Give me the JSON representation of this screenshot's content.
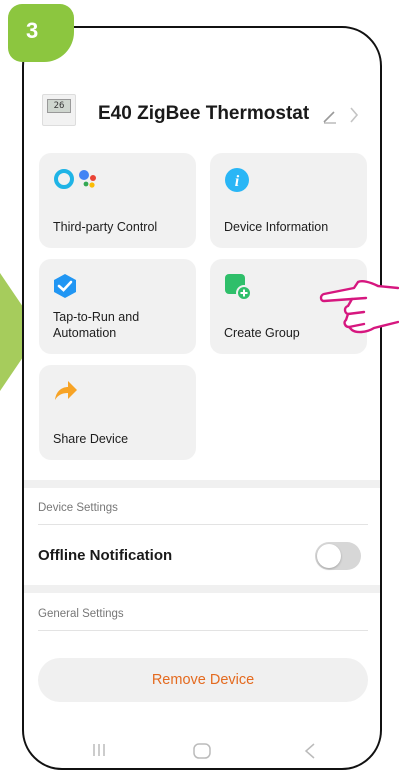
{
  "step": {
    "number": "3",
    "color": "#8cc63f"
  },
  "header": {
    "device_display": "26",
    "title": "E40 ZigBee Thermostat",
    "edit_icon": "pencil-icon",
    "chevron_icon": "chevron-right-icon"
  },
  "tiles": [
    {
      "label": "Third-party Control",
      "icon": "alexa-google-assistant-icons"
    },
    {
      "label": "Device Information",
      "icon": "info-icon"
    },
    {
      "label": "Tap-to-Run and\nAutomation",
      "icon": "automation-check-icon"
    },
    {
      "label": "Create Group",
      "icon": "create-group-icon"
    },
    {
      "label": "Share Device",
      "icon": "share-arrow-icon"
    }
  ],
  "device_settings": {
    "section_title": "Device Settings",
    "offline_notification": {
      "label": "Offline Notification",
      "enabled": false
    }
  },
  "general_settings": {
    "section_title": "General Settings"
  },
  "remove_button": {
    "label": "Remove Device",
    "color": "#e46a1f"
  },
  "colors": {
    "accent_green": "#8cc63f",
    "hand_magenta": "#d6177f"
  }
}
